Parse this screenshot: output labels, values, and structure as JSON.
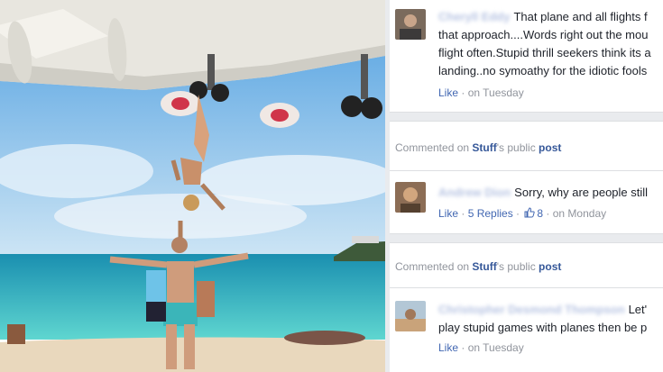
{
  "comments": [
    {
      "name": "Cheryll Eddy",
      "lines": [
        "That plane and all flights f",
        "that approach....Words right out the mou",
        "flight often.Stupid thrill seekers think its a",
        "landing..no symoathy for the idiotic fools"
      ],
      "actions": {
        "like": "Like",
        "time": "on Tuesday"
      }
    },
    {
      "meta": {
        "prefix": "Commented on",
        "page": "Stuff",
        "middle": "'s public",
        "target": "post"
      }
    },
    {
      "name": "Andrew Dion",
      "lines": [
        "Sorry, why are people still"
      ],
      "actions": {
        "like": "Like",
        "replies": "5 Replies",
        "count": "8",
        "time": "on Monday"
      }
    },
    {
      "meta": {
        "prefix": "Commented on",
        "page": "Stuff",
        "middle": "'s public",
        "target": "post"
      }
    },
    {
      "name": "Christopher Desmond Thompson",
      "lines": [
        "Let'",
        "play stupid games with planes then be p"
      ],
      "actions": {
        "like": "Like",
        "time": "on Tuesday"
      }
    }
  ],
  "icons": [
    "thumbs-up-icon"
  ],
  "colors": {
    "link": "#4267b2",
    "meta": "#90949c",
    "text": "#1d2129",
    "sky": "#6fb3e8",
    "sea": "#2fbcc4"
  }
}
